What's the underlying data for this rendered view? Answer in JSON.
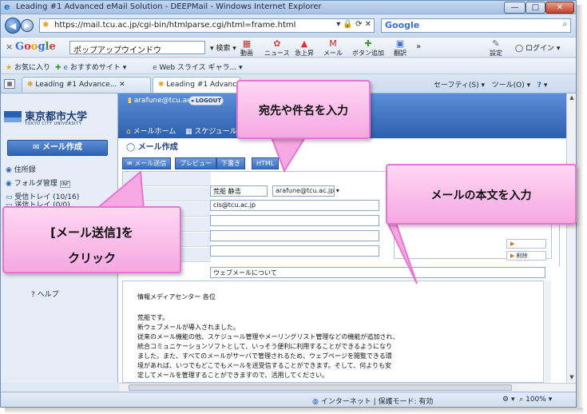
{
  "window": {
    "title": "Leading #1 Advanced eMail Solution - DEEPMail - Windows Internet Explorer",
    "minimize": "—",
    "maximize": "□",
    "close": "✕"
  },
  "address": {
    "url": "https://mail.tcu.ac.jp/cgi-bin/htmlparse.cgi/html=frame.html",
    "search_engine": "Google"
  },
  "google_toolbar": {
    "close": "×",
    "logo": [
      "G",
      "o",
      "o",
      "g",
      "l",
      "e"
    ],
    "input_value": "ポップアップウインドウ",
    "search_label": "検索",
    "items": [
      {
        "icon": "film-icon",
        "label": "動画"
      },
      {
        "icon": "news-icon",
        "label": "ニュース"
      },
      {
        "icon": "arrow-up-icon",
        "label": "急上昇"
      },
      {
        "icon": "gmail-icon",
        "label": "メール"
      },
      {
        "icon": "plus-icon",
        "label": "ボタン追加"
      },
      {
        "icon": "translate-icon",
        "label": "翻訳"
      }
    ],
    "settings": "設定",
    "login": "ログイン",
    "more": "»"
  },
  "favorites": {
    "fav": "お気に入り",
    "recommended": "おすすめサイト",
    "webslice": "Web スライス ギャラ..."
  },
  "tabs": [
    {
      "label": "Leading #1 Advance..."
    },
    {
      "label": "Leading #1 Advanced e..."
    }
  ],
  "command_bar": {
    "safety": "セーフティ(S)",
    "tools": "ツール(O)",
    "help": "?"
  },
  "mail": {
    "user_email": "arafune@tcu.ac.jp",
    "logout": "LOGOUT",
    "university_name": "東京都市大学",
    "university_sub": "TOKYO CITY UNIVERSITY",
    "menu": [
      "メールホーム",
      "スケジュール"
    ],
    "compose": "メール作成",
    "sidebar": [
      {
        "label": "住所録"
      },
      {
        "label": "フォルダ管理"
      },
      {
        "label": "受信トレイ (10/16)"
      },
      {
        "label": "送信トレイ (0/0)"
      }
    ],
    "help_link": "? ヘルプ",
    "section_title": "メール作成",
    "actions": [
      "メール送信",
      "プレビュー",
      "下書き",
      "HTML"
    ],
    "from_name": "荒船 静浩",
    "from_address": "arafune@tcu.ac.jp",
    "to_value": "cis@tcu.ac.jp",
    "subject_value": "ウェブメールについて",
    "side_button": "削除",
    "body_lines": [
      "情報メディアセンター 各位",
      "",
      "荒船です。",
      "新ウェブメールが導入されました。",
      "従来のメール機能の他、スケジュール管理やメーリングリスト管理などの機能が追加され、",
      "統合コミュニケーションソフトとして、いっそう便利に利用することができるようになり",
      "ました。また、すべてのメールがサーバで管理されるため、ウェブページを閲覧できる環",
      "境があれば、いつでもどこでもメールを送受信することができます。そして、何よりも安",
      "定してメールを管理することができますので、活用してください。"
    ]
  },
  "status": {
    "zone": "インターネット | 保護モード: 有効",
    "zoom": "100%"
  },
  "callouts": {
    "subject": "宛先や件名を入力",
    "body": "メールの本文を入力",
    "send_line1": "[メール送信]を",
    "send_line2": "クリック"
  },
  "colors": {
    "callout_fill": "#f5a8e2",
    "callout_border": "#e477cf",
    "mail_header": "#2e5fae",
    "action_button": "#3a6cbd"
  }
}
